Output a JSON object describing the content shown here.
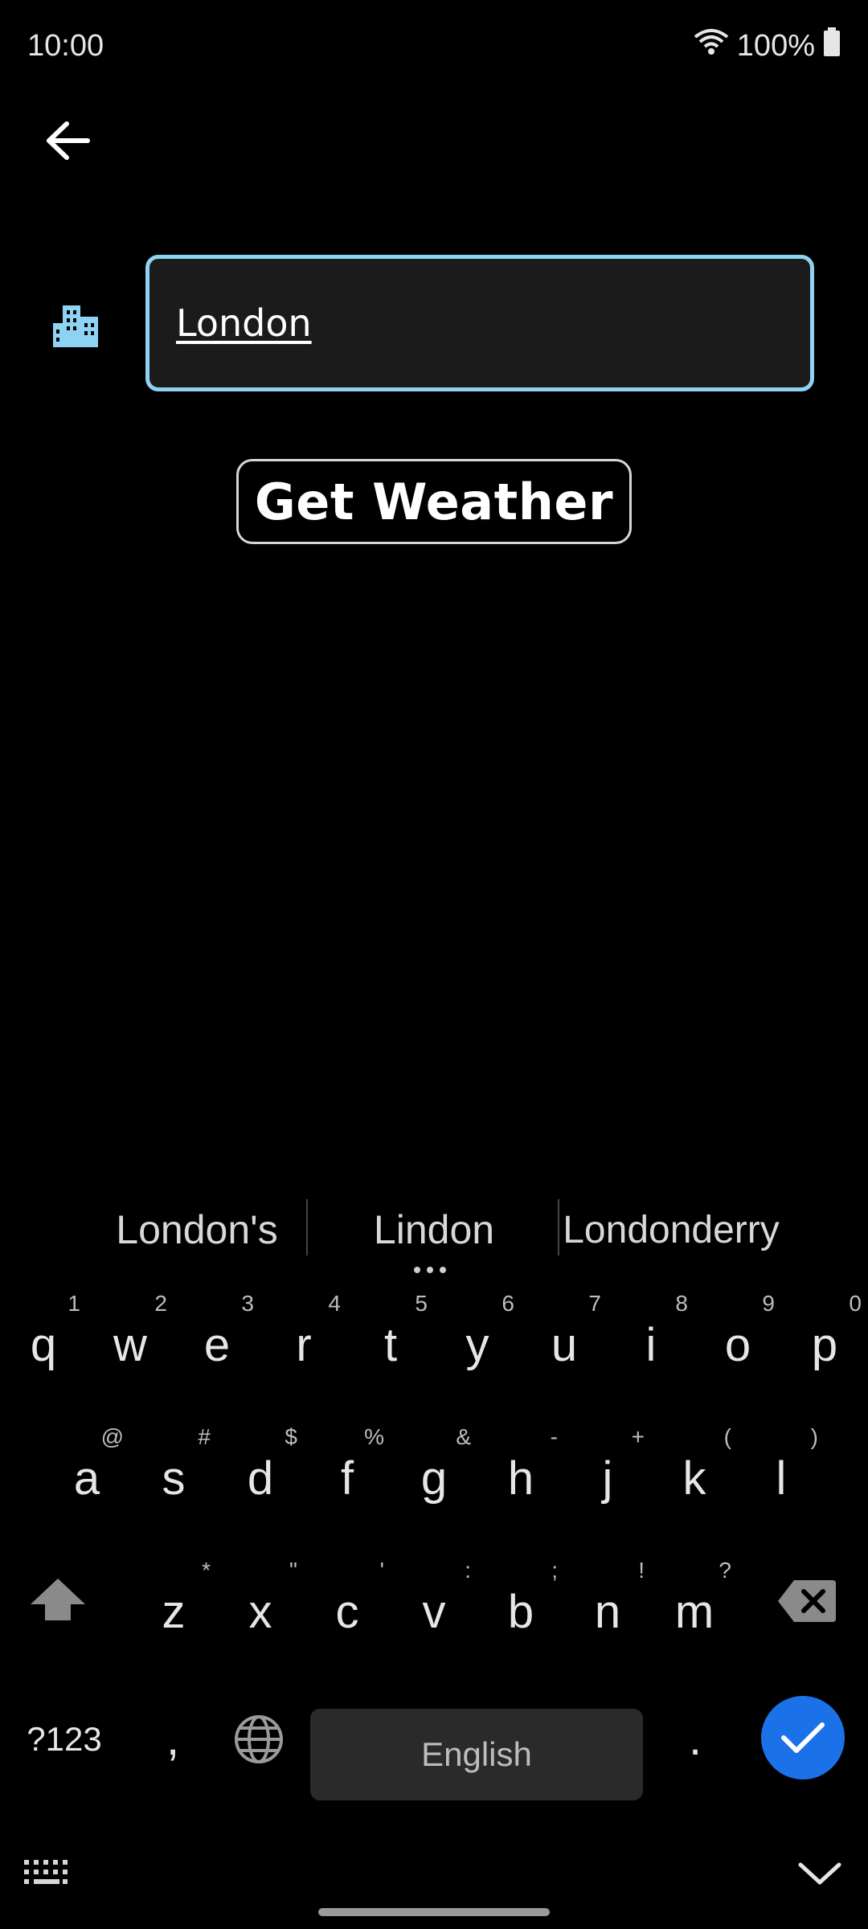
{
  "status": {
    "time": "10:00",
    "battery": "100%"
  },
  "search": {
    "city_value": "London"
  },
  "actions": {
    "get_weather": "Get Weather"
  },
  "suggestions": [
    "London's",
    "Lindon",
    "Londonderry"
  ],
  "keyboard": {
    "row1": [
      {
        "k": "q",
        "h": "1"
      },
      {
        "k": "w",
        "h": "2"
      },
      {
        "k": "e",
        "h": "3"
      },
      {
        "k": "r",
        "h": "4"
      },
      {
        "k": "t",
        "h": "5"
      },
      {
        "k": "y",
        "h": "6"
      },
      {
        "k": "u",
        "h": "7"
      },
      {
        "k": "i",
        "h": "8"
      },
      {
        "k": "o",
        "h": "9"
      },
      {
        "k": "p",
        "h": "0"
      }
    ],
    "row2": [
      {
        "k": "a",
        "h": "@"
      },
      {
        "k": "s",
        "h": "#"
      },
      {
        "k": "d",
        "h": "$"
      },
      {
        "k": "f",
        "h": "%"
      },
      {
        "k": "g",
        "h": "&"
      },
      {
        "k": "h",
        "h": "-"
      },
      {
        "k": "j",
        "h": "+"
      },
      {
        "k": "k",
        "h": "("
      },
      {
        "k": "l",
        "h": ")"
      }
    ],
    "row3": [
      {
        "k": "z",
        "h": "*"
      },
      {
        "k": "x",
        "h": "\""
      },
      {
        "k": "c",
        "h": "'"
      },
      {
        "k": "v",
        "h": ":"
      },
      {
        "k": "b",
        "h": ";"
      },
      {
        "k": "n",
        "h": "!"
      },
      {
        "k": "m",
        "h": "?"
      }
    ],
    "symbols_label": "?123",
    "comma": ",",
    "space_label": "English",
    "period": "."
  },
  "colors": {
    "accent": "#8fd3f4",
    "enter": "#1b72e8",
    "background": "#000000"
  },
  "icons": {
    "back": "arrow-left-icon",
    "city": "city-buildings-icon",
    "wifi": "wifi-icon",
    "battery": "battery-icon",
    "shift": "shift-icon",
    "backspace": "backspace-icon",
    "globe": "globe-icon",
    "enter": "check-icon",
    "keyboard": "keyboard-icon",
    "hide": "chevron-down-icon"
  }
}
